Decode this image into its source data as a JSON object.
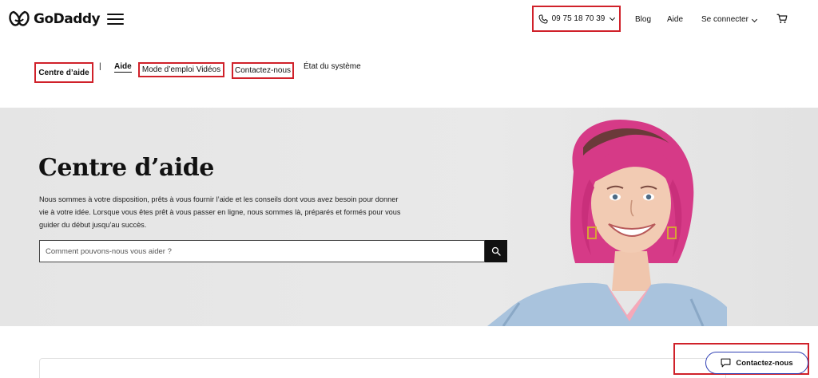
{
  "header": {
    "brand": "GoDaddy",
    "phone": "09 75 18 70 39",
    "nav": {
      "blog": "Blog",
      "aide": "Aide",
      "connect": "Se connecter"
    }
  },
  "subnav": {
    "centre": "Centre d’aide",
    "separator": "|",
    "aide": "Aide",
    "videos": "Mode d’emploi Vidéos",
    "contact": "Contactez-nous",
    "etat": "État du système"
  },
  "hero": {
    "title": "Centre d’aide",
    "description": "Nous sommes à votre disposition, prêts à vous fournir l’aide et les conseils dont vous avez besoin pour donner vie à votre idée. Lorsque vous êtes prêt à vous passer en ligne, nous sommes là, préparés et formés pour vous guider du début jusqu’au succès.",
    "search_placeholder": "Comment pouvons-nous vous aider ?"
  },
  "chat": {
    "label": "Contactez-nous"
  },
  "colors": {
    "highlight": "#d0212a",
    "chat_border": "#2f3fb4",
    "hero_bg": "#e8e8e8",
    "hair": "#d63a87"
  }
}
